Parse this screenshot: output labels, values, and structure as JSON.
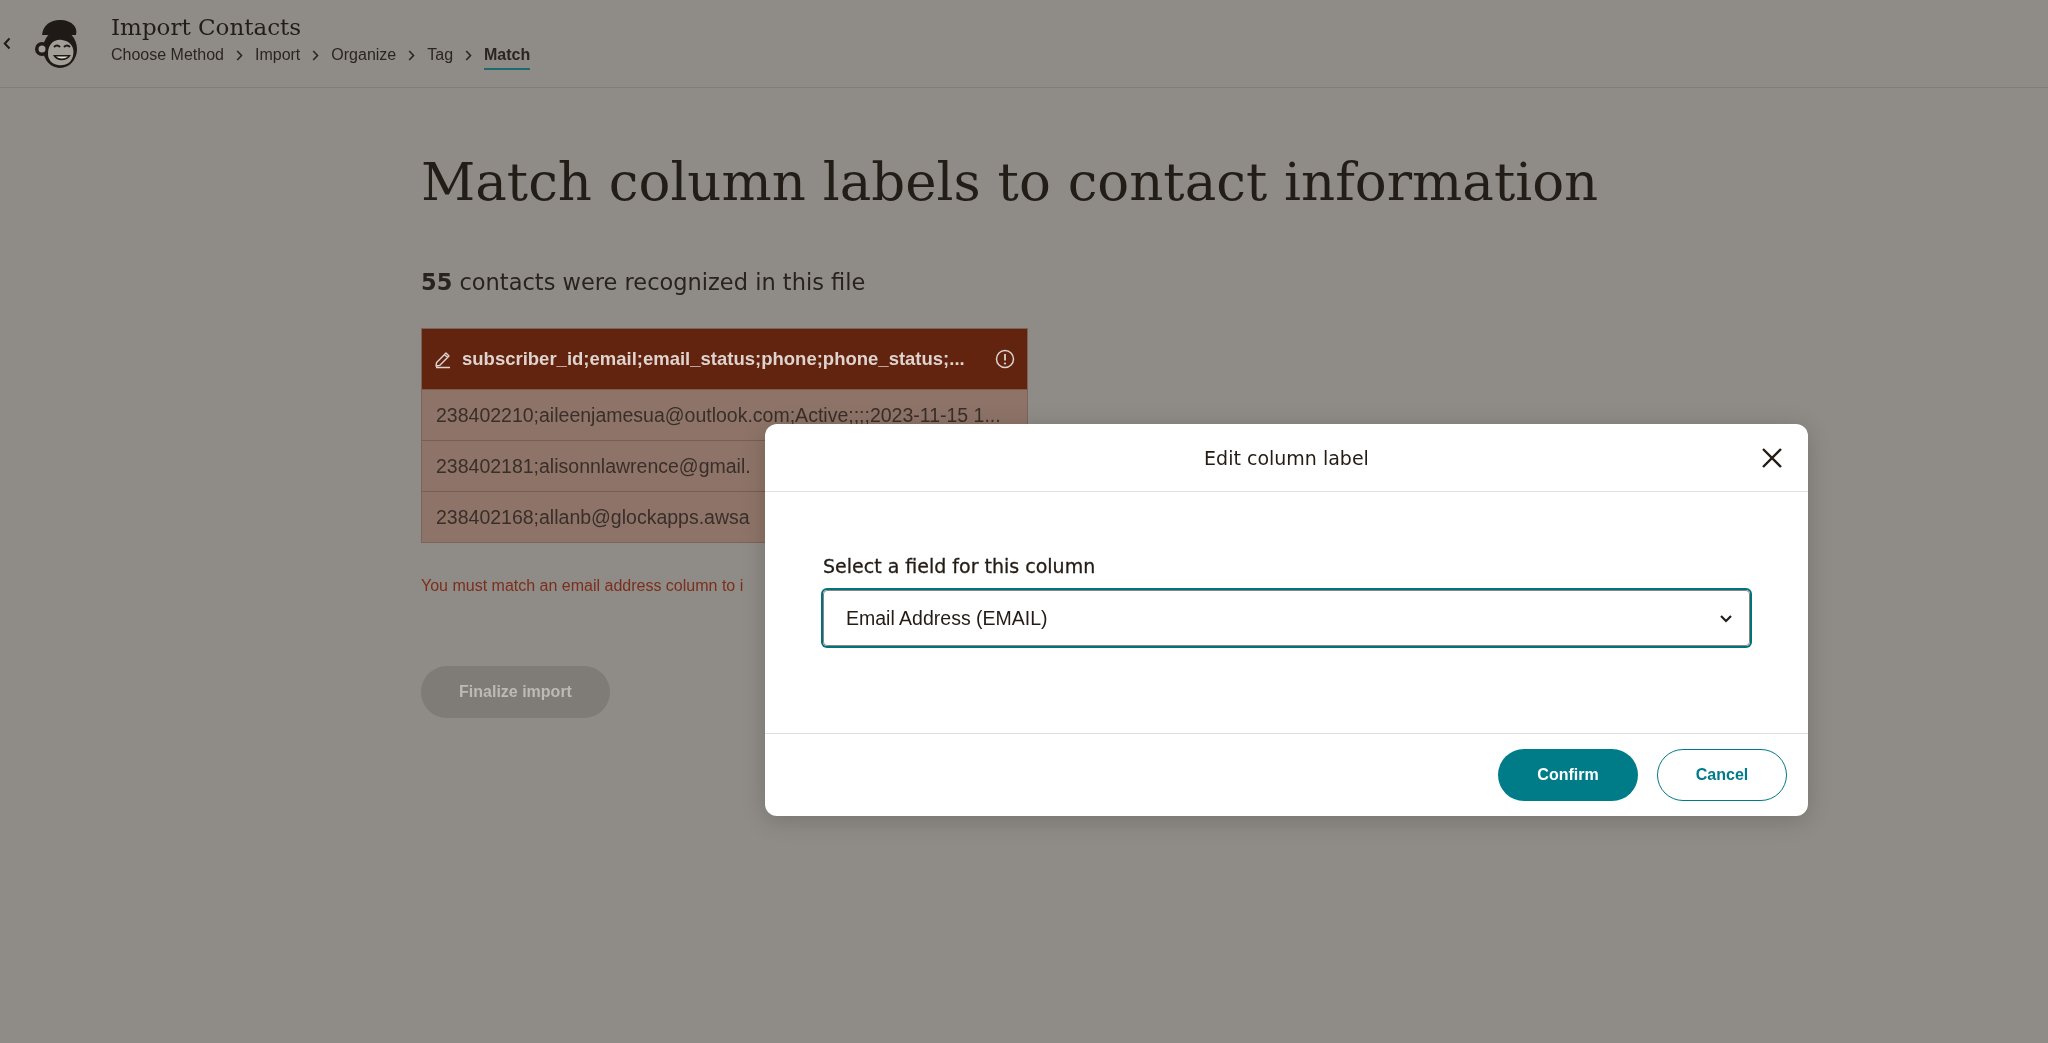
{
  "header": {
    "title": "Import Contacts",
    "breadcrumbs": [
      {
        "label": "Choose Method",
        "selected": false
      },
      {
        "label": "Import",
        "selected": false
      },
      {
        "label": "Organize",
        "selected": false
      },
      {
        "label": "Tag",
        "selected": false
      },
      {
        "label": "Match",
        "selected": true
      }
    ]
  },
  "page": {
    "heading": "Match column labels to contact information",
    "summary": "**55** contacts were recognized in this file",
    "table": {
      "column_header": {
        "label": "subscriber_id;email;email_status;phone;phone_status;...",
        "unmatched": true
      },
      "rows": [
        "238402210;aileenjamesua@outlook.com;Active;;;;2023-11-15 1...",
        "238402181;alisonnlawrence@gmail.",
        "238402168;allanb@glockapps.awsa"
      ]
    },
    "error": "You must match an email address column to i",
    "finalize_button": {
      "label": "Finalize import",
      "disabled": true
    }
  },
  "modal": {
    "title": "Edit column label",
    "field": {
      "label": "Select a field for this column",
      "value": "Email Address (EMAIL)",
      "focused": true
    },
    "buttons": [
      {
        "label": "Confirm",
        "kind": "primary"
      },
      {
        "label": "Cancel",
        "kind": "secondary"
      }
    ]
  }
}
